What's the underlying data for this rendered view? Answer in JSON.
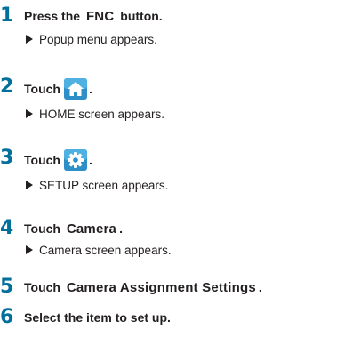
{
  "steps": [
    {
      "num": "1",
      "pre": "Press the",
      "keyword": "FNC",
      "post": "button.",
      "result": "Popup menu appears."
    },
    {
      "num": "2",
      "pre": "Touch",
      "icon": "home-icon",
      "post": ".",
      "result": "HOME screen appears."
    },
    {
      "num": "3",
      "pre": "Touch",
      "icon": "gear-icon",
      "post": ".",
      "result": "SETUP screen appears."
    },
    {
      "num": "4",
      "pre": "Touch",
      "keyword": "Camera",
      "post": ".",
      "result": "Camera screen appears."
    },
    {
      "num": "5",
      "pre": "Touch",
      "keyword": "Camera Assignment Settings",
      "post": "."
    },
    {
      "num": "6",
      "text": "Select the item to set up."
    }
  ],
  "colors": {
    "step_number": "#006f9a",
    "icon_bg": "#2e8fc8",
    "text": "#231f20"
  }
}
